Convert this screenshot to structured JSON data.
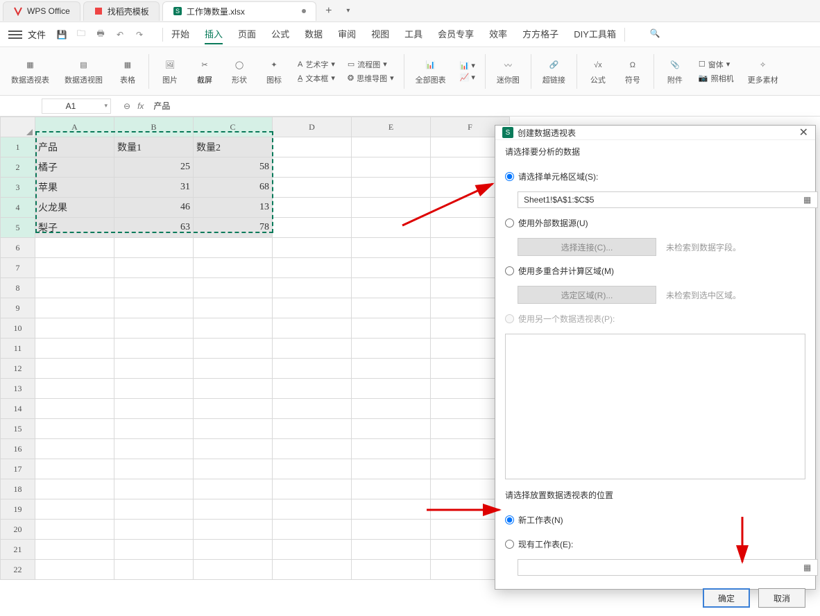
{
  "tabs": {
    "t1": "WPS Office",
    "t2": "找稻壳模板",
    "t3": "工作簿数量.xlsx"
  },
  "menu": {
    "file": "文件",
    "items": [
      "开始",
      "插入",
      "页面",
      "公式",
      "数据",
      "审阅",
      "视图",
      "工具",
      "会员专享",
      "效率",
      "方方格子",
      "DIY工具箱"
    ]
  },
  "ribbon": {
    "g1": "数据透视表",
    "g2": "数据透视图",
    "g3": "表格",
    "g4": "图片",
    "g5": "截屏",
    "g6": "形状",
    "g7": "图标",
    "art": "艺术字",
    "txtbox": "文本框",
    "flow": "流程图",
    "mind": "思维导图",
    "g8": "全部图表",
    "g9": "迷你图",
    "g10": "超链接",
    "g11": "公式",
    "g12": "符号",
    "g13": "附件",
    "g14": "窗体",
    "g15": "照相机",
    "g16": "更多素材"
  },
  "formula": {
    "cellref": "A1",
    "value": "产品"
  },
  "sheet": {
    "cols": [
      "A",
      "B",
      "C",
      "D",
      "E",
      "F"
    ],
    "headers": [
      "产品",
      "数量1",
      "数量2"
    ],
    "rows": [
      [
        "橘子",
        "25",
        "58"
      ],
      [
        "苹果",
        "31",
        "68"
      ],
      [
        "火龙果",
        "46",
        "13"
      ],
      [
        "梨子",
        "63",
        "78"
      ]
    ]
  },
  "dialog": {
    "title": "创建数据透视表",
    "sec1": "请选择要分析的数据",
    "opt1": "请选择单元格区域(S):",
    "range": "Sheet1!$A$1:$C$5",
    "opt2": "使用外部数据源(U)",
    "btn1": "选择连接(C)...",
    "hint1": "未检索到数据字段。",
    "opt3": "使用多重合并计算区域(M)",
    "btn2": "选定区域(R)...",
    "hint2": "未检索到选中区域。",
    "opt4": "使用另一个数据透视表(P):",
    "sec2": "请选择放置数据透视表的位置",
    "opt5": "新工作表(N)",
    "opt6": "现有工作表(E):",
    "ok": "确定",
    "cancel": "取消"
  }
}
